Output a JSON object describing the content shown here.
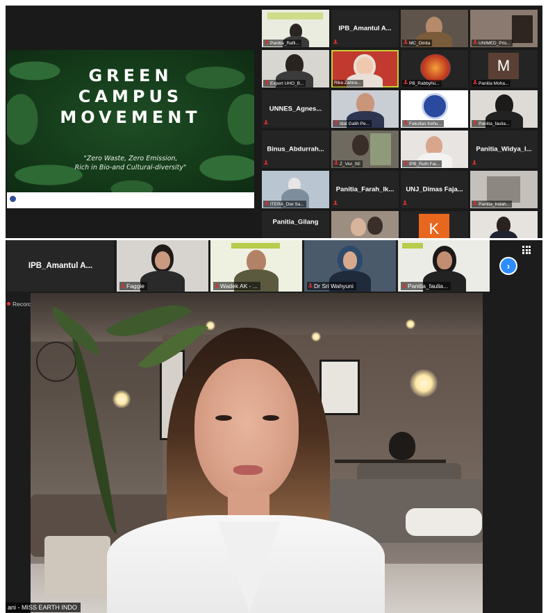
{
  "gallery": {
    "slide": {
      "title_lines": [
        "GREEN",
        "CAMPUS",
        "MOVEMENT"
      ],
      "tagline_lines": [
        "\"Zero Waste, Zero Emission,",
        "Rich in Bio-and Cultural-diversity\""
      ]
    },
    "tiles": [
      {
        "label": "Panitia_Rafli...",
        "kind": "video"
      },
      {
        "label": "IPB_Amantul A...",
        "kind": "name"
      },
      {
        "label": "MC_Dinita",
        "kind": "video"
      },
      {
        "label": "UNIMED_Pris...",
        "kind": "video"
      },
      {
        "label": "Expert UHO_B...",
        "kind": "video"
      },
      {
        "label": "Rika Zahira...",
        "kind": "video",
        "active": true
      },
      {
        "label": "PB_Rabbyhu...",
        "kind": "video"
      },
      {
        "label": "Panitia Moha...",
        "kind": "avatar",
        "avatar_letter": "M"
      },
      {
        "label": "UNNES_Agnes...",
        "kind": "name"
      },
      {
        "label": "Idat Galih Pe...",
        "kind": "video"
      },
      {
        "label": "Fakultas Kehu...",
        "kind": "video"
      },
      {
        "label": "Panitia_faulia...",
        "kind": "video"
      },
      {
        "label": "Binus_Abdurrah...",
        "kind": "name"
      },
      {
        "label": "Z_Vivi_SE",
        "kind": "video"
      },
      {
        "label": "IPB_Ruth Fai...",
        "kind": "video"
      },
      {
        "label": "Panitia_Widya_I...",
        "kind": "name"
      },
      {
        "label": "ITERA_Dwi Sa...",
        "kind": "video"
      },
      {
        "label": "Panitia_Farah_Ik...",
        "kind": "name"
      },
      {
        "label": "UNJ_Dimas Faja...",
        "kind": "name"
      },
      {
        "label": "Panitia_Indah...",
        "kind": "video"
      },
      {
        "label": "Panitia_Gilang",
        "kind": "name"
      },
      {
        "label": "",
        "kind": "video"
      },
      {
        "label": "",
        "kind": "avatar",
        "avatar_letter": "K"
      },
      {
        "label": "",
        "kind": "video"
      }
    ]
  },
  "speaker_view": {
    "strip": [
      {
        "label": "IPB_Amantul A...",
        "kind": "name"
      },
      {
        "label": "Faggie",
        "kind": "video"
      },
      {
        "label": "Wadek AK - ...",
        "kind": "video"
      },
      {
        "label": "Dr Sri Wahyuni",
        "kind": "video"
      },
      {
        "label": "Panitia_faulia...",
        "kind": "video"
      }
    ],
    "recording_label": "Recording",
    "speaker_name": "ani - MISS EARTH INDO"
  },
  "colors": {
    "active_speaker_outline": "#c7d136",
    "mute_icon": "#d32f2f",
    "next_button": "#2d8cff",
    "avatar_m": "#5a4034",
    "avatar_k": "#e8671f"
  },
  "icons": [
    "microphone-muted-icon",
    "chevron-right-icon",
    "grid-view-icon",
    "recording-dot-icon"
  ]
}
